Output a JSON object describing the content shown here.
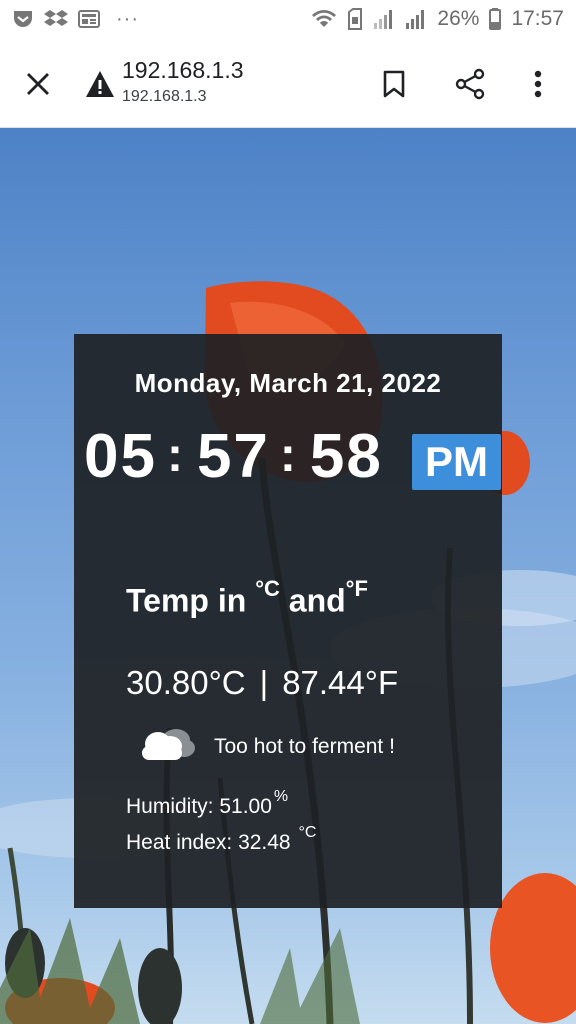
{
  "status_bar": {
    "dots": "···",
    "battery": "26%",
    "time": "17:57",
    "icons": [
      "pocket-icon",
      "dropbox-icon",
      "news-icon",
      "wifi-icon",
      "sim-icon",
      "signal-icon",
      "signal-icon",
      "battery-icon"
    ]
  },
  "toolbar": {
    "title": "192.168.1.3",
    "url": "192.168.1.3",
    "icons": [
      "close-icon",
      "warning-icon",
      "bookmark-icon",
      "share-icon",
      "more-vert-icon"
    ]
  },
  "clock": {
    "date": "Monday, March 21, 2022",
    "hours": "05",
    "minutes": "57",
    "seconds": "58",
    "separator": ":",
    "ampm": "PM",
    "ampm_color": "#3d8fdb"
  },
  "weather": {
    "heading_prefix": "Temp in",
    "unit_c": "°C",
    "heading_and": "and",
    "unit_f": "°F",
    "temp_c": "30.80°C",
    "divider": "|",
    "temp_f": "87.44°F",
    "icon": "cloud-icon",
    "message": "Too hot to ferment !",
    "humidity_label": "Humidity: 51.00",
    "humidity_unit": "%",
    "heatindex_label": "Heat index: 32.48",
    "heatindex_unit": "°C"
  }
}
